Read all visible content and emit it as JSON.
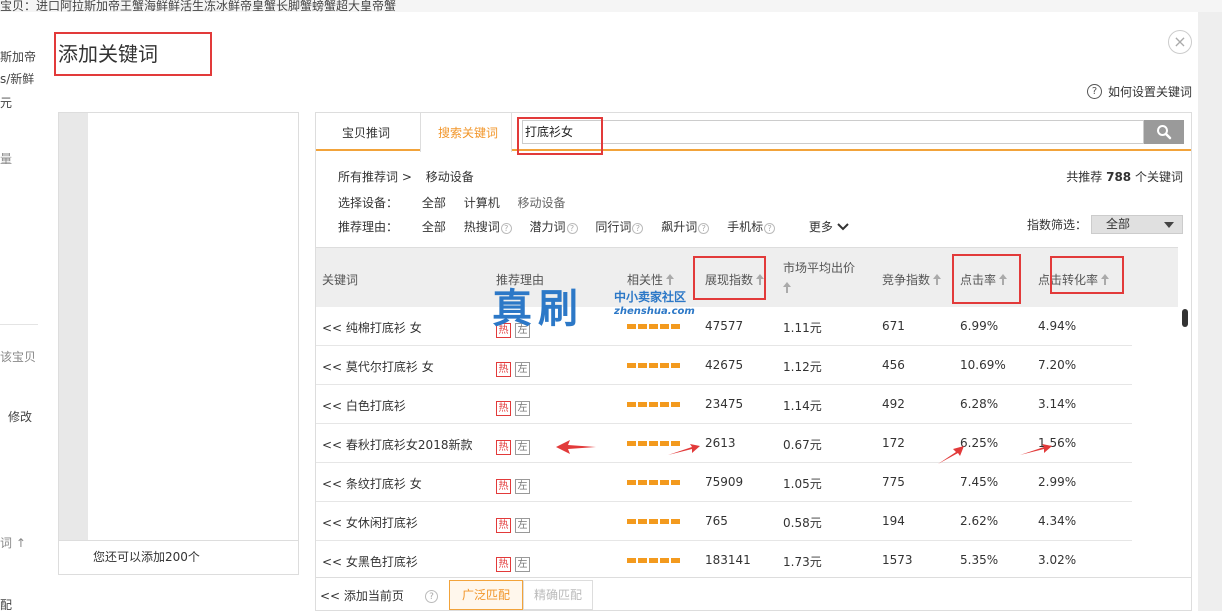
{
  "background": {
    "top_line": "宝贝：进口阿拉斯加帝王蟹海鲜鲜活生冻冰鲜帝皇蟹长脚蟹螃蟹超大皇帝蟹",
    "left_snippets": [
      "斯加帝",
      "s/新鲜",
      "元",
      "量",
      "该宝贝",
      "修改",
      "词 ↑",
      "配"
    ]
  },
  "modal": {
    "title": "添加关键词",
    "close_glyph": "×",
    "help_label": "如何设置关键词",
    "left_panel": {
      "footer_text": "您还可以添加200个"
    },
    "tabs": [
      {
        "label": "宝贝推词",
        "active": false
      },
      {
        "label": "搜索关键词",
        "active": true
      }
    ],
    "search": {
      "value": "打底衫女"
    },
    "breadcrumb": [
      "所有推荐词 >",
      "移动设备"
    ],
    "recommend_count": {
      "prefix": "共推荐",
      "count": "788",
      "suffix": "个关键词"
    },
    "device_filter": {
      "label": "选择设备：",
      "options": [
        "全部",
        "计算机",
        "移动设备"
      ]
    },
    "reason_filter": {
      "label": "推荐理由：",
      "options": [
        "全部",
        "热搜词",
        "潜力词",
        "同行词",
        "飙升词",
        "手机标"
      ],
      "more": "更多"
    },
    "index_filter": {
      "label": "指数筛选：",
      "value": "全部"
    },
    "columns": {
      "keyword": "关键词",
      "reason": "推荐理由",
      "relevance": "相关性",
      "impressions": "展现指数",
      "avg_bid": "市场平均出价",
      "competition": "竞争指数",
      "ctr": "点击率",
      "cvr": "点击转化率"
    },
    "rows": [
      {
        "keyword": "<< 纯棉打底衫 女",
        "hot": "热",
        "left": "左",
        "impressions": "47577",
        "avg_bid": "1.11元",
        "competition": "671",
        "ctr": "6.99%",
        "cvr": "4.94%"
      },
      {
        "keyword": "<< 莫代尔打底衫 女",
        "hot": "热",
        "left": "左",
        "impressions": "42675",
        "avg_bid": "1.12元",
        "competition": "456",
        "ctr": "10.69%",
        "cvr": "7.20%"
      },
      {
        "keyword": "<< 白色打底衫",
        "hot": "热",
        "left": "左",
        "impressions": "23475",
        "avg_bid": "1.14元",
        "competition": "492",
        "ctr": "6.28%",
        "cvr": "3.14%"
      },
      {
        "keyword": "<< 春秋打底衫女2018新款",
        "hot": "热",
        "left": "左",
        "impressions": "2613",
        "avg_bid": "0.67元",
        "competition": "172",
        "ctr": "6.25%",
        "cvr": "1.56%"
      },
      {
        "keyword": "<< 条纹打底衫 女",
        "hot": "热",
        "left": "左",
        "impressions": "75909",
        "avg_bid": "1.05元",
        "competition": "775",
        "ctr": "7.45%",
        "cvr": "2.99%"
      },
      {
        "keyword": "<< 女休闲打底衫",
        "hot": "热",
        "left": "左",
        "impressions": "765",
        "avg_bid": "0.58元",
        "competition": "194",
        "ctr": "2.62%",
        "cvr": "4.34%"
      },
      {
        "keyword": "<< 女黑色打底衫",
        "hot": "热",
        "left": "左",
        "impressions": "183141",
        "avg_bid": "1.73元",
        "competition": "1573",
        "ctr": "5.35%",
        "cvr": "3.02%"
      }
    ],
    "footer": {
      "add_page": "<< 添加当前页",
      "broad_match": "广泛匹配",
      "exact_match": "精确匹配"
    },
    "watermark": {
      "big": "真刷",
      "small": "中小卖家社区",
      "url": "zhenshua.com"
    }
  },
  "colors": {
    "accent": "#f2962a",
    "annotation_red": "#e23a3a",
    "watermark_blue": "#2c78c7"
  }
}
